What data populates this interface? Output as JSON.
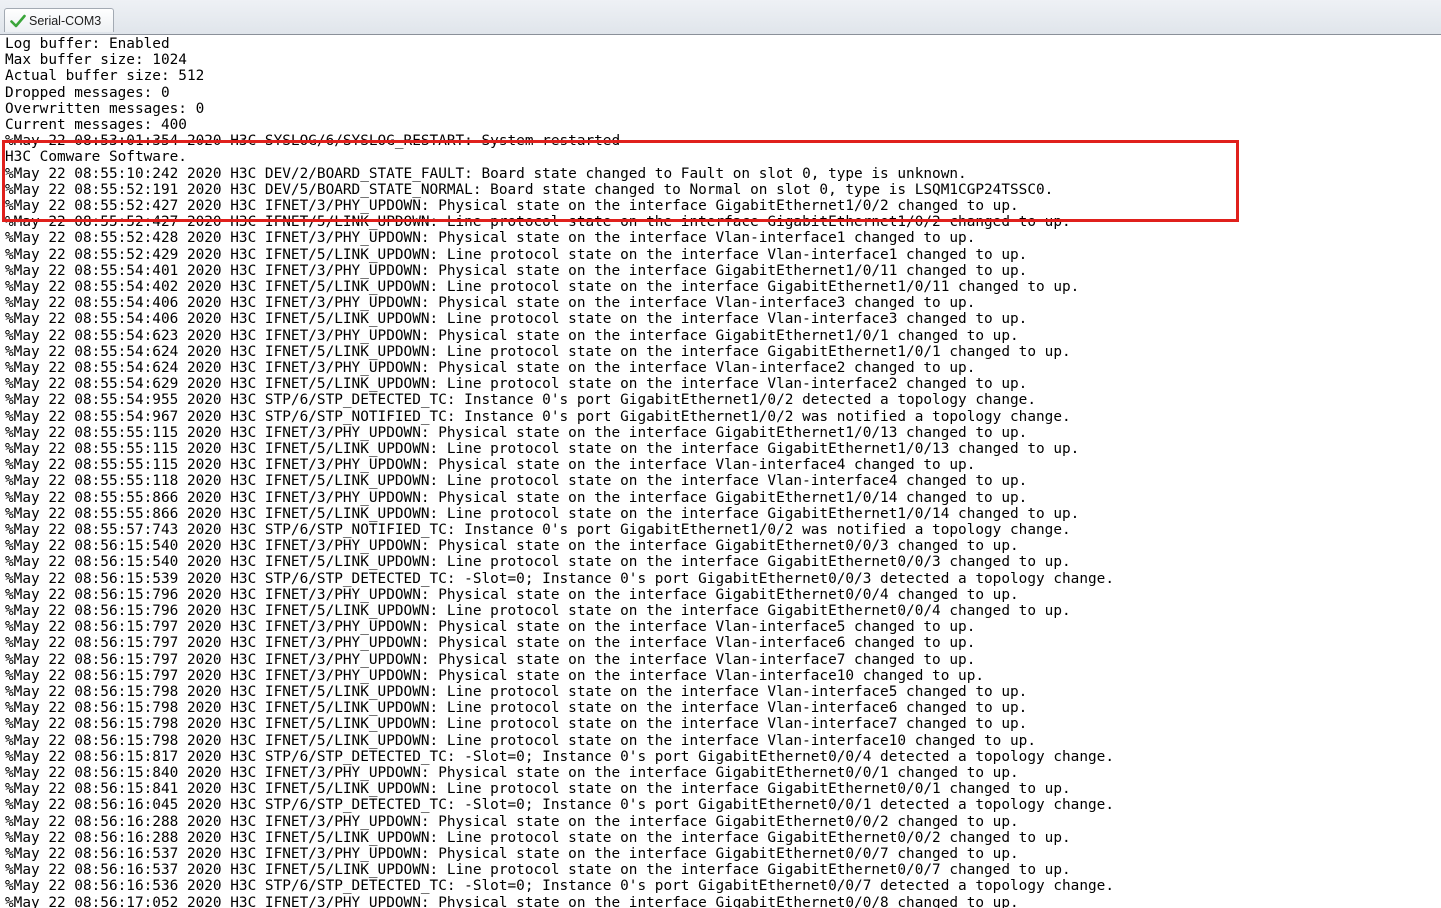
{
  "window": {
    "tab_label": "Serial-COM3",
    "tab_icon": "checkmark-icon"
  },
  "colors": {
    "highlight_border": "#e0201c",
    "text": "#000000",
    "background": "#ffffff"
  },
  "console": {
    "lines": [
      "Log buffer: Enabled",
      "Max buffer size: 1024",
      "Actual buffer size: 512",
      "Dropped messages: 0",
      "Overwritten messages: 0",
      "Current messages: 400",
      "%May 22 08:53:01:354 2020 H3C SYSLOG/6/SYSLOG_RESTART: System restarted",
      "H3C Comware Software.",
      "%May 22 08:55:10:242 2020 H3C DEV/2/BOARD_STATE_FAULT: Board state changed to Fault on slot 0, type is unknown.",
      "%May 22 08:55:52:191 2020 H3C DEV/5/BOARD_STATE_NORMAL: Board state changed to Normal on slot 0, type is LSQM1CGP24TSSC0.",
      "%May 22 08:55:52:427 2020 H3C IFNET/3/PHY_UPDOWN: Physical state on the interface GigabitEthernet1/0/2 changed to up.",
      "%May 22 08:55:52:427 2020 H3C IFNET/5/LINK_UPDOWN: Line protocol state on the interface GigabitEthernet1/0/2 changed to up.",
      "%May 22 08:55:52:428 2020 H3C IFNET/3/PHY_UPDOWN: Physical state on the interface Vlan-interface1 changed to up.",
      "%May 22 08:55:52:429 2020 H3C IFNET/5/LINK_UPDOWN: Line protocol state on the interface Vlan-interface1 changed to up.",
      "%May 22 08:55:54:401 2020 H3C IFNET/3/PHY_UPDOWN: Physical state on the interface GigabitEthernet1/0/11 changed to up.",
      "%May 22 08:55:54:402 2020 H3C IFNET/5/LINK_UPDOWN: Line protocol state on the interface GigabitEthernet1/0/11 changed to up.",
      "%May 22 08:55:54:406 2020 H3C IFNET/3/PHY_UPDOWN: Physical state on the interface Vlan-interface3 changed to up.",
      "%May 22 08:55:54:406 2020 H3C IFNET/5/LINK_UPDOWN: Line protocol state on the interface Vlan-interface3 changed to up.",
      "%May 22 08:55:54:623 2020 H3C IFNET/3/PHY_UPDOWN: Physical state on the interface GigabitEthernet1/0/1 changed to up.",
      "%May 22 08:55:54:624 2020 H3C IFNET/5/LINK_UPDOWN: Line protocol state on the interface GigabitEthernet1/0/1 changed to up.",
      "%May 22 08:55:54:624 2020 H3C IFNET/3/PHY_UPDOWN: Physical state on the interface Vlan-interface2 changed to up.",
      "%May 22 08:55:54:629 2020 H3C IFNET/5/LINK_UPDOWN: Line protocol state on the interface Vlan-interface2 changed to up.",
      "%May 22 08:55:54:955 2020 H3C STP/6/STP_DETECTED_TC: Instance 0's port GigabitEthernet1/0/2 detected a topology change.",
      "%May 22 08:55:54:967 2020 H3C STP/6/STP_NOTIFIED_TC: Instance 0's port GigabitEthernet1/0/2 was notified a topology change.",
      "%May 22 08:55:55:115 2020 H3C IFNET/3/PHY_UPDOWN: Physical state on the interface GigabitEthernet1/0/13 changed to up.",
      "%May 22 08:55:55:115 2020 H3C IFNET/5/LINK_UPDOWN: Line protocol state on the interface GigabitEthernet1/0/13 changed to up.",
      "%May 22 08:55:55:115 2020 H3C IFNET/3/PHY_UPDOWN: Physical state on the interface Vlan-interface4 changed to up.",
      "%May 22 08:55:55:118 2020 H3C IFNET/5/LINK_UPDOWN: Line protocol state on the interface Vlan-interface4 changed to up.",
      "%May 22 08:55:55:866 2020 H3C IFNET/3/PHY_UPDOWN: Physical state on the interface GigabitEthernet1/0/14 changed to up.",
      "%May 22 08:55:55:866 2020 H3C IFNET/5/LINK_UPDOWN: Line protocol state on the interface GigabitEthernet1/0/14 changed to up.",
      "%May 22 08:55:57:743 2020 H3C STP/6/STP_NOTIFIED_TC: Instance 0's port GigabitEthernet1/0/2 was notified a topology change.",
      "%May 22 08:56:15:540 2020 H3C IFNET/3/PHY_UPDOWN: Physical state on the interface GigabitEthernet0/0/3 changed to up.",
      "%May 22 08:56:15:540 2020 H3C IFNET/5/LINK_UPDOWN: Line protocol state on the interface GigabitEthernet0/0/3 changed to up.",
      "%May 22 08:56:15:539 2020 H3C STP/6/STP_DETECTED_TC: -Slot=0; Instance 0's port GigabitEthernet0/0/3 detected a topology change.",
      "%May 22 08:56:15:796 2020 H3C IFNET/3/PHY_UPDOWN: Physical state on the interface GigabitEthernet0/0/4 changed to up.",
      "%May 22 08:56:15:796 2020 H3C IFNET/5/LINK_UPDOWN: Line protocol state on the interface GigabitEthernet0/0/4 changed to up.",
      "%May 22 08:56:15:797 2020 H3C IFNET/3/PHY_UPDOWN: Physical state on the interface Vlan-interface5 changed to up.",
      "%May 22 08:56:15:797 2020 H3C IFNET/3/PHY_UPDOWN: Physical state on the interface Vlan-interface6 changed to up.",
      "%May 22 08:56:15:797 2020 H3C IFNET/3/PHY_UPDOWN: Physical state on the interface Vlan-interface7 changed to up.",
      "%May 22 08:56:15:797 2020 H3C IFNET/3/PHY_UPDOWN: Physical state on the interface Vlan-interface10 changed to up.",
      "%May 22 08:56:15:798 2020 H3C IFNET/5/LINK_UPDOWN: Line protocol state on the interface Vlan-interface5 changed to up.",
      "%May 22 08:56:15:798 2020 H3C IFNET/5/LINK_UPDOWN: Line protocol state on the interface Vlan-interface6 changed to up.",
      "%May 22 08:56:15:798 2020 H3C IFNET/5/LINK_UPDOWN: Line protocol state on the interface Vlan-interface7 changed to up.",
      "%May 22 08:56:15:798 2020 H3C IFNET/5/LINK_UPDOWN: Line protocol state on the interface Vlan-interface10 changed to up.",
      "%May 22 08:56:15:817 2020 H3C STP/6/STP_DETECTED_TC: -Slot=0; Instance 0's port GigabitEthernet0/0/4 detected a topology change.",
      "%May 22 08:56:15:840 2020 H3C IFNET/3/PHY_UPDOWN: Physical state on the interface GigabitEthernet0/0/1 changed to up.",
      "%May 22 08:56:15:841 2020 H3C IFNET/5/LINK_UPDOWN: Line protocol state on the interface GigabitEthernet0/0/1 changed to up.",
      "%May 22 08:56:16:045 2020 H3C STP/6/STP_DETECTED_TC: -Slot=0; Instance 0's port GigabitEthernet0/0/1 detected a topology change.",
      "%May 22 08:56:16:288 2020 H3C IFNET/3/PHY_UPDOWN: Physical state on the interface GigabitEthernet0/0/2 changed to up.",
      "%May 22 08:56:16:288 2020 H3C IFNET/5/LINK_UPDOWN: Line protocol state on the interface GigabitEthernet0/0/2 changed to up.",
      "%May 22 08:56:16:537 2020 H3C IFNET/3/PHY_UPDOWN: Physical state on the interface GigabitEthernet0/0/7 changed to up.",
      "%May 22 08:56:16:537 2020 H3C IFNET/5/LINK_UPDOWN: Line protocol state on the interface GigabitEthernet0/0/7 changed to up.",
      "%May 22 08:56:16:536 2020 H3C STP/6/STP_DETECTED_TC: -Slot=0; Instance 0's port GigabitEthernet0/0/7 detected a topology change.",
      "%May 22 08:56:17:052 2020 H3C IFNET/3/PHY_UPDOWN: Physical state on the interface GigabitEthernet0/0/8 changed to up."
    ]
  }
}
